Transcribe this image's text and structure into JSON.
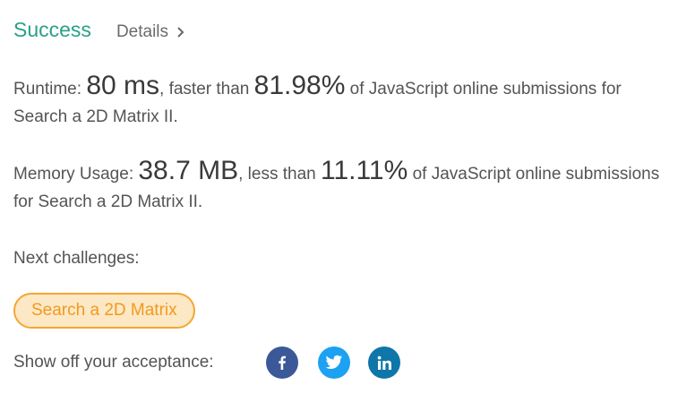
{
  "header": {
    "status": "Success",
    "details_label": "Details"
  },
  "runtime": {
    "label": "Runtime: ",
    "value": "80 ms",
    "mid": ", faster than ",
    "percent": "81.98%",
    "suffix": " of JavaScript online submissions for Search a 2D Matrix II."
  },
  "memory": {
    "label": "Memory Usage: ",
    "value": "38.7 MB",
    "mid": ", less than ",
    "percent": "11.11%",
    "suffix": " of JavaScript online submissions for Search a 2D Matrix II."
  },
  "next": {
    "label": "Next challenges:",
    "challenges": [
      "Search a 2D Matrix"
    ]
  },
  "share": {
    "label": "Show off your acceptance:",
    "icons": [
      "facebook-icon",
      "twitter-icon",
      "linkedin-icon"
    ]
  },
  "colors": {
    "success": "#2aa08a",
    "challenge_border": "#f5a631",
    "challenge_bg": "#fde8c6",
    "facebook": "#3b5998",
    "twitter": "#1da1f2",
    "linkedin": "#0e76a8"
  }
}
